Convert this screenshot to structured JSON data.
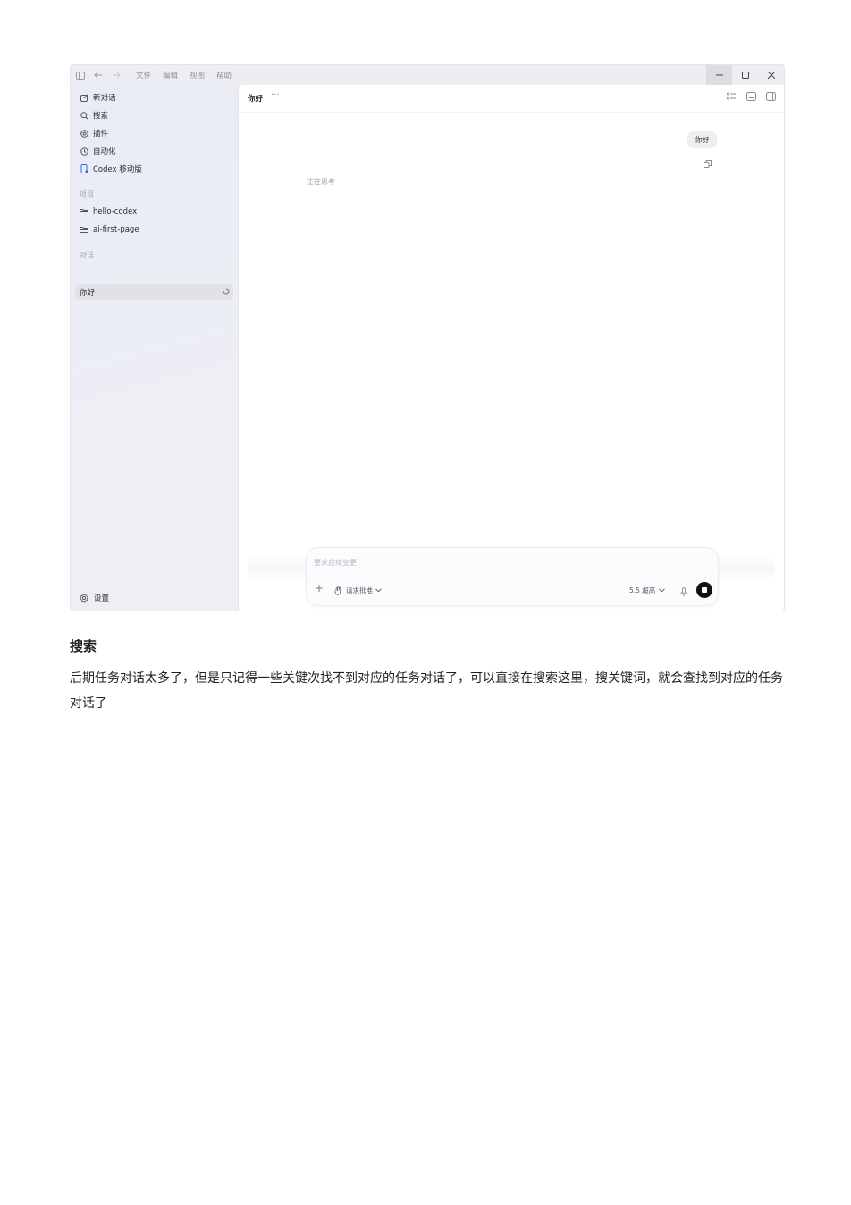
{
  "menu": [
    "文件",
    "编辑",
    "视图",
    "帮助"
  ],
  "sidebar": {
    "items": [
      {
        "label": "新对话",
        "icon": "edit-icon"
      },
      {
        "label": "搜索",
        "icon": "search-icon"
      },
      {
        "label": "插件",
        "icon": "at-icon"
      },
      {
        "label": "自动化",
        "icon": "clock-icon"
      },
      {
        "label": "Codex 移动版",
        "icon": "phone-icon"
      }
    ],
    "projects_label": "项目",
    "projects": [
      "hello-codex",
      "ai-first-page"
    ],
    "chats_label": "对话",
    "chats": [
      {
        "label": "你好",
        "active": true
      }
    ],
    "settings_label": "设置"
  },
  "main": {
    "chat_title": "你好",
    "more": "···",
    "user_message": "你好",
    "thinking_text": "正在思考",
    "composer": {
      "placeholder": "要求后续变更",
      "approve_label": "请求批准",
      "model_label": "5.5 超高"
    }
  },
  "doc": {
    "heading": "搜索",
    "paragraph": "后期任务对话太多了，但是只记得一些关键次找不到对应的任务对话了，可以直接在搜索这里，搜关键词，就会查找到对应的任务对话了"
  },
  "colors": {
    "accent_stop": "#111111",
    "sidebar_bg": "#eceef6"
  }
}
